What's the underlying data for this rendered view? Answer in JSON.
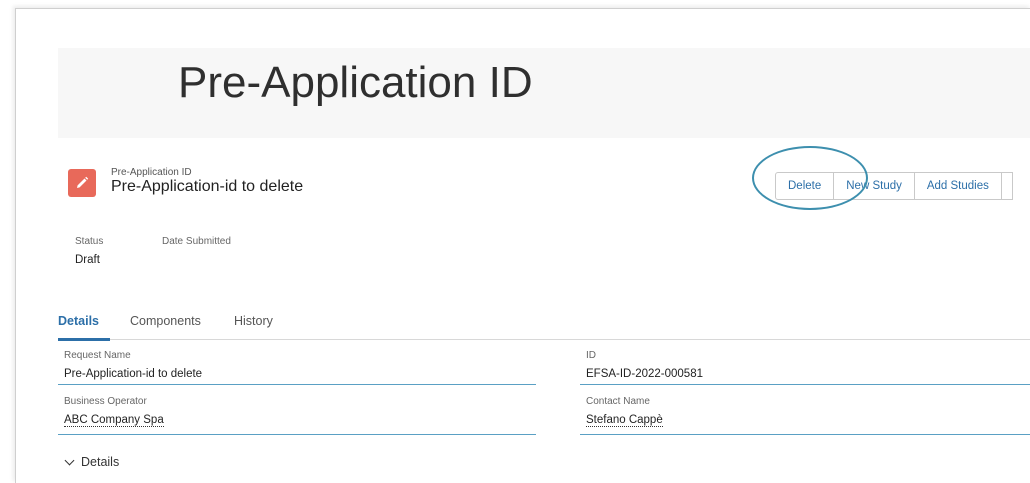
{
  "banner": {
    "title": "Pre-Application ID"
  },
  "record": {
    "type_label": "Pre-Application ID",
    "name": "Pre-Application-id to delete",
    "icon": "pencil-icon",
    "icon_color": "#e8695a"
  },
  "actions": {
    "delete": "Delete",
    "new_study": "New Study",
    "add_studies": "Add Studies"
  },
  "highlights": {
    "status_label": "Status",
    "status_value": "Draft",
    "date_submitted_label": "Date Submitted"
  },
  "tabs": [
    "Details",
    "Components",
    "History"
  ],
  "fields": {
    "request_name_label": "Request Name",
    "request_name_value": "Pre-Application-id to delete",
    "id_label": "ID",
    "id_value": "EFSA-ID-2022-000581",
    "business_operator_label": "Business Operator",
    "business_operator_value": "ABC Company Spa",
    "contact_name_label": "Contact Name",
    "contact_name_value": "Stefano Cappè"
  },
  "section": {
    "label": "Details"
  },
  "colors": {
    "accent": "#2c6fa8",
    "annotation": "#3d8fae"
  }
}
